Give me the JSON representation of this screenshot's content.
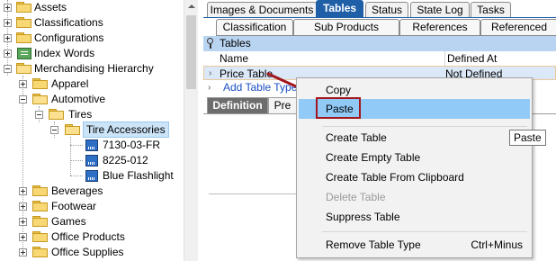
{
  "tree": {
    "items": [
      {
        "label": "Assets",
        "expander": "plus",
        "icon": "folder"
      },
      {
        "label": "Classifications",
        "expander": "plus",
        "icon": "folder"
      },
      {
        "label": "Configurations",
        "expander": "plus",
        "icon": "folder"
      },
      {
        "label": "Index Words",
        "expander": "plus",
        "icon": "book"
      },
      {
        "label": "Merchandising Hierarchy",
        "expander": "minus",
        "icon": "folder-open"
      },
      {
        "label": "Apparel",
        "expander": "plus",
        "icon": "folder"
      },
      {
        "label": "Automotive",
        "expander": "minus",
        "icon": "folder-open"
      },
      {
        "label": "Tires",
        "expander": "minus",
        "icon": "folder-open"
      },
      {
        "label": "Tire Accessories",
        "expander": "minus",
        "icon": "folder-open",
        "selected": true
      },
      {
        "label": "7130-03-FR",
        "icon": "product"
      },
      {
        "label": "8225-012",
        "icon": "product"
      },
      {
        "label": "Blue Flashlight",
        "icon": "product"
      },
      {
        "label": "Beverages",
        "expander": "plus",
        "icon": "folder"
      },
      {
        "label": "Footwear",
        "expander": "plus",
        "icon": "folder"
      },
      {
        "label": "Games",
        "expander": "plus",
        "icon": "folder"
      },
      {
        "label": "Office Products",
        "expander": "plus",
        "icon": "folder"
      },
      {
        "label": "Office Supplies",
        "expander": "plus",
        "icon": "folder"
      }
    ]
  },
  "tabs_top": [
    "Images & Documents",
    "Tables",
    "Status",
    "State Log",
    "Tasks"
  ],
  "tabs_top_active": "Tables",
  "tabs_second": [
    "Classification",
    "Sub Products",
    "References",
    "Referenced"
  ],
  "tables_panel": {
    "title": "Tables",
    "columns": [
      "Name",
      "Defined At"
    ],
    "rows": [
      {
        "name": "Price Table",
        "defined_at": "Not Defined"
      }
    ],
    "add_link": "Add Table Type"
  },
  "subtabs": [
    "Definition",
    "Pre"
  ],
  "context_menu": {
    "items": [
      {
        "label": "Copy"
      },
      {
        "label": "Paste",
        "highlighted": true
      },
      {
        "label": "Create Table"
      },
      {
        "label": "Create Empty Table"
      },
      {
        "label": "Create Table From Clipboard"
      },
      {
        "label": "Delete Table",
        "disabled": true
      },
      {
        "label": "Suppress Table"
      },
      {
        "label": "Remove Table Type",
        "shortcut": "Ctrl+Minus"
      }
    ]
  },
  "tooltip": "Paste",
  "colors": {
    "tab_active": "#1f5fa8",
    "menu_highlight": "#91c9f7",
    "annotation_red": "#a3161c",
    "selection": "#cce4f7"
  }
}
